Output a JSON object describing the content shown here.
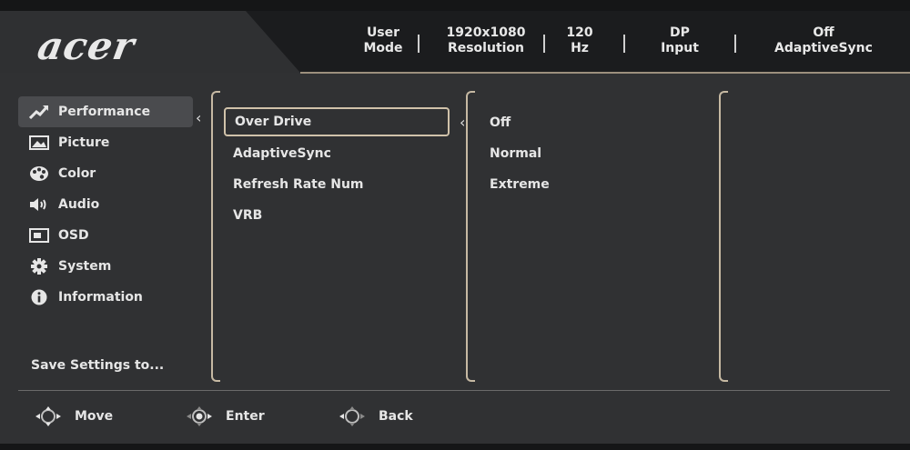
{
  "logo": "acer",
  "status": [
    {
      "line1": "User",
      "line2": "Mode"
    },
    {
      "line1": "1920x1080",
      "line2": "Resolution"
    },
    {
      "line1": "120",
      "line2": "Hz"
    },
    {
      "line1": "DP",
      "line2": "Input"
    },
    {
      "line1": "Off",
      "line2": "AdaptiveSync"
    }
  ],
  "nav": {
    "items": [
      {
        "label": "Performance",
        "icon": "performance-icon"
      },
      {
        "label": "Picture",
        "icon": "picture-icon"
      },
      {
        "label": "Color",
        "icon": "color-palette-icon"
      },
      {
        "label": "Audio",
        "icon": "speaker-icon"
      },
      {
        "label": "OSD",
        "icon": "osd-window-icon"
      },
      {
        "label": "System",
        "icon": "gear-icon"
      },
      {
        "label": "Information",
        "icon": "info-icon"
      }
    ],
    "save_label": "Save Settings to..."
  },
  "settings": {
    "items": [
      "Over Drive",
      "AdaptiveSync",
      "Refresh Rate Num",
      "VRB"
    ]
  },
  "options": {
    "items": [
      "Off",
      "Normal",
      "Extreme"
    ]
  },
  "footer": {
    "move": "Move",
    "enter": "Enter",
    "back": "Back"
  },
  "colors": {
    "accent_border": "#c6b9a3",
    "background": "#303133",
    "text": "#e6e6e6"
  }
}
